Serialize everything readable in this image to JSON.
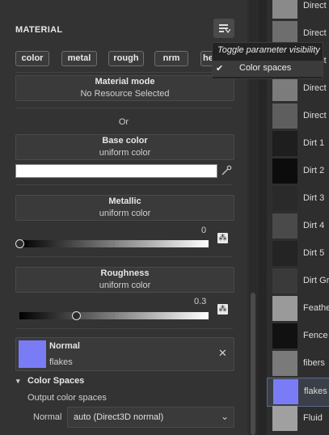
{
  "section": {
    "title": "MATERIAL"
  },
  "chips": [
    "color",
    "metal",
    "rough",
    "nrm",
    "he"
  ],
  "material_mode": {
    "title": "Material mode",
    "value": "No Resource Selected"
  },
  "or_label": "Or",
  "base_color": {
    "title": "Base color",
    "value": "uniform color",
    "swatch": "#ffffff"
  },
  "metallic": {
    "title": "Metallic",
    "value": "uniform color",
    "slider_value": "0",
    "fraction": 0.0
  },
  "roughness": {
    "title": "Roughness",
    "value": "uniform color",
    "slider_value": "0.3",
    "fraction": 0.3
  },
  "normal": {
    "title": "Normal",
    "value": "flakes",
    "swatch": "#7a7cf6"
  },
  "color_spaces": {
    "title": "Color Spaces",
    "subtitle": "Output color spaces",
    "normal_label": "Normal",
    "normal_value": "auto (Direct3D normal)"
  },
  "tooltip": {
    "title": "Toggle parameter visibility",
    "item": "Color spaces",
    "checked": true
  },
  "browser": {
    "items": [
      {
        "label": "Direct",
        "color": "#8a8a8a"
      },
      {
        "label": "Direct",
        "color": "#6e6e6e"
      },
      {
        "label": "Direct",
        "color": "#555555"
      },
      {
        "label": "Direct",
        "color": "#7c7c7c"
      },
      {
        "label": "Direct",
        "color": "#5e5e5e"
      },
      {
        "label": "Dirt 1",
        "color": "#1e1e1e"
      },
      {
        "label": "Dirt 2",
        "color": "#0c0c0c"
      },
      {
        "label": "Dirt 3",
        "color": "#2a2a2a"
      },
      {
        "label": "Dirt 4",
        "color": "#4a4a4a"
      },
      {
        "label": "Dirt 5",
        "color": "#242424"
      },
      {
        "label": "Dirt Gr",
        "color": "#3a3a3a"
      },
      {
        "label": "Feathe",
        "color": "#9a9a9a"
      },
      {
        "label": "Fence",
        "color": "#111111"
      },
      {
        "label": "fibers",
        "color": "#7a7a7a"
      },
      {
        "label": "flakes",
        "color": "#7a7cf6",
        "selected": true
      },
      {
        "label": "Fluid",
        "color": "#a0a0a0"
      }
    ]
  }
}
